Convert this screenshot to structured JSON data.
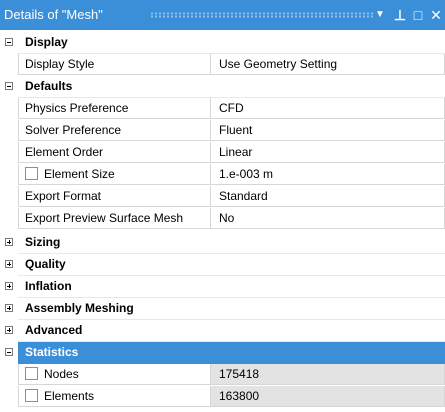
{
  "panel": {
    "title": "Details of \"Mesh\"",
    "controls": {
      "dropdown": "▼",
      "pin": "⊥",
      "maximize": "□",
      "close": "✕"
    }
  },
  "sections": {
    "display": {
      "label": "Display",
      "expanded": true,
      "rows": [
        {
          "name": "Display Style",
          "value": "Use Geometry Setting"
        }
      ]
    },
    "defaults": {
      "label": "Defaults",
      "expanded": true,
      "rows": [
        {
          "name": "Physics Preference",
          "value": "CFD"
        },
        {
          "name": "Solver Preference",
          "value": "Fluent"
        },
        {
          "name": "Element Order",
          "value": "Linear"
        },
        {
          "name": "Element Size",
          "value": "1.e-003 m",
          "checkbox": true
        },
        {
          "name": "Export Format",
          "value": "Standard"
        },
        {
          "name": "Export Preview Surface Mesh",
          "value": "No"
        }
      ]
    },
    "sizing": {
      "label": "Sizing",
      "expanded": false
    },
    "quality": {
      "label": "Quality",
      "expanded": false
    },
    "inflation": {
      "label": "Inflation",
      "expanded": false
    },
    "assembly": {
      "label": "Assembly Meshing",
      "expanded": false
    },
    "advanced": {
      "label": "Advanced",
      "expanded": false
    },
    "statistics": {
      "label": "Statistics",
      "expanded": true,
      "selected": true,
      "rows": [
        {
          "name": "Nodes",
          "value": "175418",
          "checkbox": true
        },
        {
          "name": "Elements",
          "value": "163800",
          "checkbox": true
        }
      ]
    }
  },
  "colors": {
    "accent": "#3b8fd9",
    "readonly_bg": "#e3e3e3",
    "grid_line": "#d6d6d6"
  }
}
